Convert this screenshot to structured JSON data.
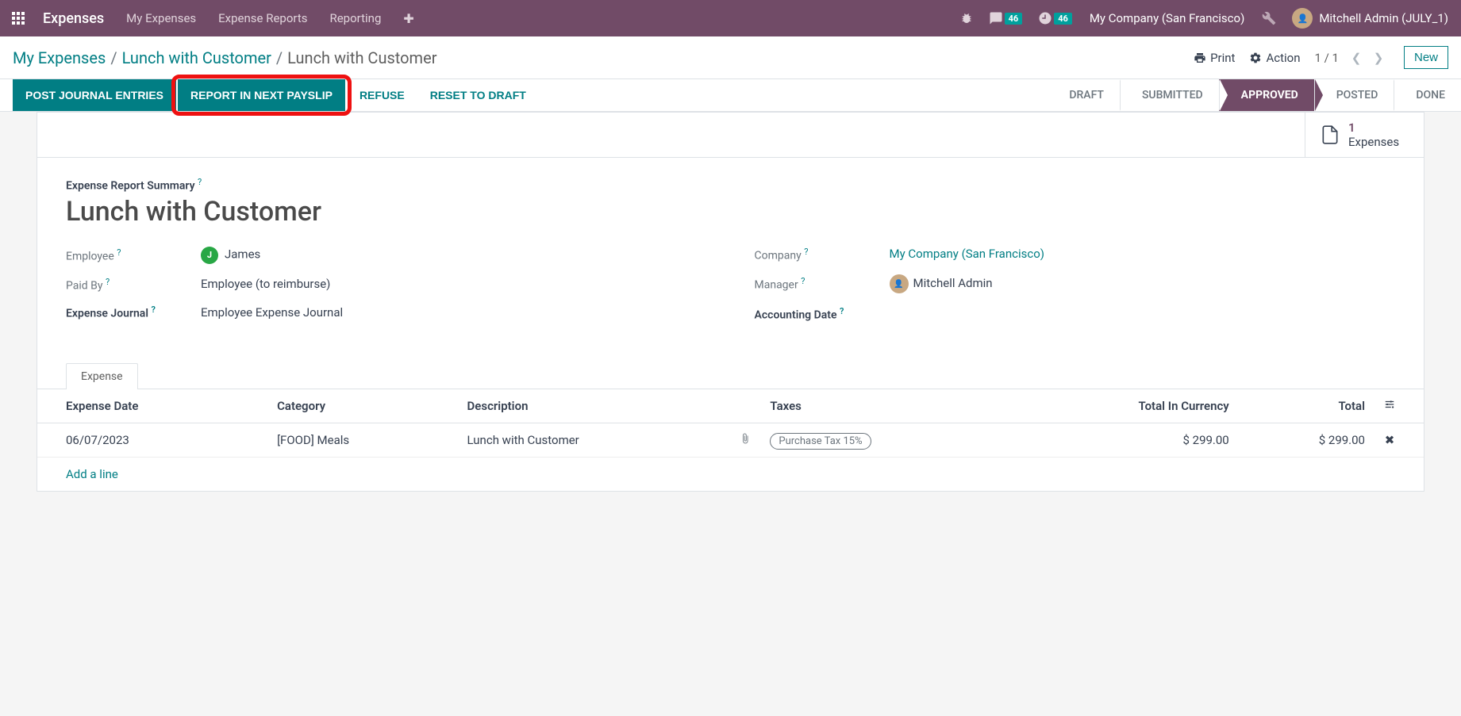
{
  "navbar": {
    "brand": "Expenses",
    "items": [
      "My Expenses",
      "Expense Reports",
      "Reporting"
    ],
    "msg_count": "46",
    "activity_count": "46",
    "company": "My Company (San Francisco)",
    "user": "Mitchell Admin (JULY_1)"
  },
  "breadcrumb": {
    "root": "My Expenses",
    "mid": "Lunch with Customer",
    "current": "Lunch with Customer"
  },
  "controls": {
    "print": "Print",
    "action": "Action",
    "pager": "1 / 1",
    "new": "New"
  },
  "buttons": {
    "post": "POST JOURNAL ENTRIES",
    "report_payslip": "REPORT IN NEXT PAYSLIP",
    "refuse": "REFUSE",
    "reset": "RESET TO DRAFT"
  },
  "status": [
    "DRAFT",
    "SUBMITTED",
    "APPROVED",
    "POSTED",
    "DONE"
  ],
  "status_active_index": 2,
  "stat": {
    "num": "1",
    "label": "Expenses"
  },
  "form": {
    "summary_label": "Expense Report Summary",
    "title": "Lunch with Customer",
    "employee_label": "Employee",
    "employee_initial": "J",
    "employee_value": "James",
    "paidby_label": "Paid By",
    "paidby_value": "Employee (to reimburse)",
    "journal_label": "Expense Journal",
    "journal_value": "Employee Expense Journal",
    "company_label": "Company",
    "company_value": "My Company (San Francisco)",
    "manager_label": "Manager",
    "manager_value": "Mitchell Admin",
    "accdate_label": "Accounting Date",
    "accdate_value": ""
  },
  "tab": {
    "expense": "Expense"
  },
  "table": {
    "headers": {
      "date": "Expense Date",
      "category": "Category",
      "description": "Description",
      "taxes": "Taxes",
      "total_curr": "Total In Currency",
      "total": "Total"
    },
    "row": {
      "date": "06/07/2023",
      "category": "[FOOD] Meals",
      "description": "Lunch with Customer",
      "tax": "Purchase Tax 15%",
      "total_curr": "$ 299.00",
      "total": "$ 299.00"
    },
    "add_line": "Add a line"
  }
}
